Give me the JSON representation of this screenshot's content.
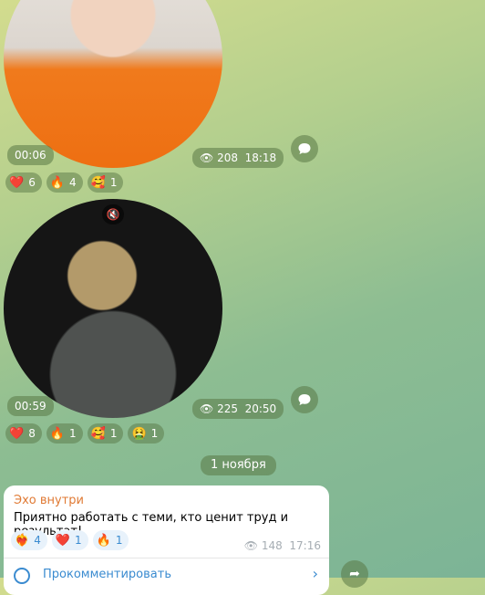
{
  "messages": [
    {
      "duration": "00:06",
      "views": "208",
      "time": "18:18",
      "reactions": [
        {
          "icon": "❤️",
          "count": "6"
        },
        {
          "icon": "🔥",
          "count": "4"
        },
        {
          "icon": "🥰",
          "count": "1"
        }
      ]
    },
    {
      "duration": "00:59",
      "views": "225",
      "time": "20:50",
      "muted": true,
      "reactions": [
        {
          "icon": "❤️",
          "count": "8"
        },
        {
          "icon": "🔥",
          "count": "1"
        },
        {
          "icon": "🥰",
          "count": "1"
        },
        {
          "icon": "🤮",
          "count": "1"
        }
      ]
    }
  ],
  "date_separator": "1 ноября",
  "post": {
    "author": "Эхо внутри",
    "text": "Приятно работать с теми, кто ценит труд и результат!",
    "reactions": [
      {
        "icon": "❤️‍🔥",
        "count": "4"
      },
      {
        "icon": "❤️",
        "count": "1"
      },
      {
        "icon": "🔥",
        "count": "1"
      }
    ],
    "views": "148",
    "time": "17:16",
    "comment_label": "Прокомментировать"
  },
  "colors": {
    "author": "#e07a34",
    "link": "#3a8bd0"
  }
}
